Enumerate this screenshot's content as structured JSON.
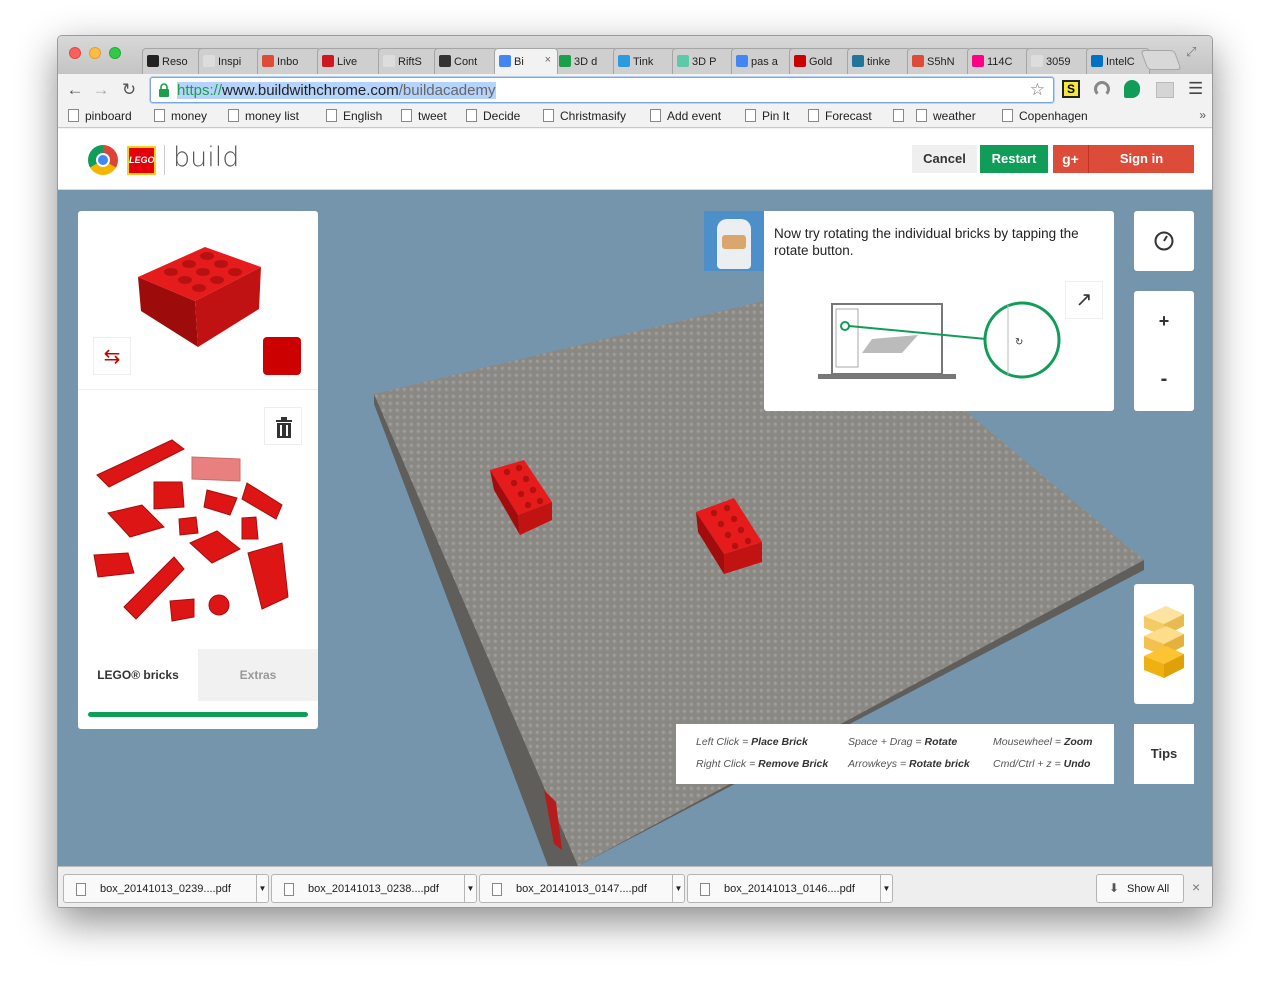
{
  "tabs": [
    {
      "label": "Reso",
      "color": "#222222"
    },
    {
      "label": "Inspi",
      "color": "#dddddd"
    },
    {
      "label": "Inbo",
      "color": "#dd4b39"
    },
    {
      "label": "Live",
      "color": "#cc181e"
    },
    {
      "label": "RiftS",
      "color": "#dddddd"
    },
    {
      "label": "Cont",
      "color": "#333333"
    },
    {
      "label": "Bi",
      "color": "#4285f4"
    },
    {
      "label": "3D d",
      "color": "#1a9f4a"
    },
    {
      "label": "Tink",
      "color": "#2b9ae0"
    },
    {
      "label": "3D P",
      "color": "#5fc8a8"
    },
    {
      "label": "pas a",
      "color": "#4285f4"
    },
    {
      "label": "Gold",
      "color": "#cc0000"
    },
    {
      "label": "tinke",
      "color": "#21759b"
    },
    {
      "label": "S5hN",
      "color": "#dd4b39"
    },
    {
      "label": "114C",
      "color": "#ff0084"
    },
    {
      "label": "3059",
      "color": "#dddddd"
    },
    {
      "label": "IntelC",
      "color": "#0071c5"
    }
  ],
  "address": {
    "scheme": "https://",
    "host": "www.buildwithchrome.com",
    "path": "/buildacademy"
  },
  "bookmarks": [
    "pinboard",
    "money",
    "money list",
    "English",
    "tweet",
    "Decide",
    "Christmasify",
    "Add event",
    "Pin It",
    "Forecast",
    "",
    "weather",
    "Copenhagen"
  ],
  "app": {
    "logo_lego": "LEGO",
    "logo_build": "build",
    "cancel_label": "Cancel",
    "restart_label": "Restart",
    "gplus_label": "g+",
    "signin_label": "Sign in"
  },
  "tutorial": {
    "text": "Now try rotating the individual bricks by tapping the rotate button."
  },
  "bricks_panel": {
    "tab_bricks": "LEGO® bricks",
    "tab_extras": "Extras",
    "selected_color": "#cc0000"
  },
  "zoom": {
    "plus": "+",
    "minus": "-"
  },
  "tips": {
    "label": "Tips",
    "left_click": "Left Click",
    "place_brick": "Place Brick",
    "right_click": "Right Click",
    "remove_brick": "Remove Brick",
    "space_drag": "Space + Drag",
    "rotate": "Rotate",
    "arrowkeys": "Arrowkeys",
    "rotate_brick": "Rotate brick",
    "mousewheel": "Mousewheel",
    "zoom": "Zoom",
    "cmd_z": "Cmd/Ctrl + z",
    "undo": "Undo",
    "equals": "="
  },
  "downloads": [
    "box_20141013_0239....pdf",
    "box_20141013_0238....pdf",
    "box_20141013_0147....pdf",
    "box_20141013_0146....pdf"
  ],
  "show_all_label": "Show All",
  "colors": {
    "accent_green": "#109d58",
    "google_red": "#dd4b39",
    "brick_red": "#cc0000",
    "baseplate": "#8a8883",
    "background": "#7595ad"
  }
}
